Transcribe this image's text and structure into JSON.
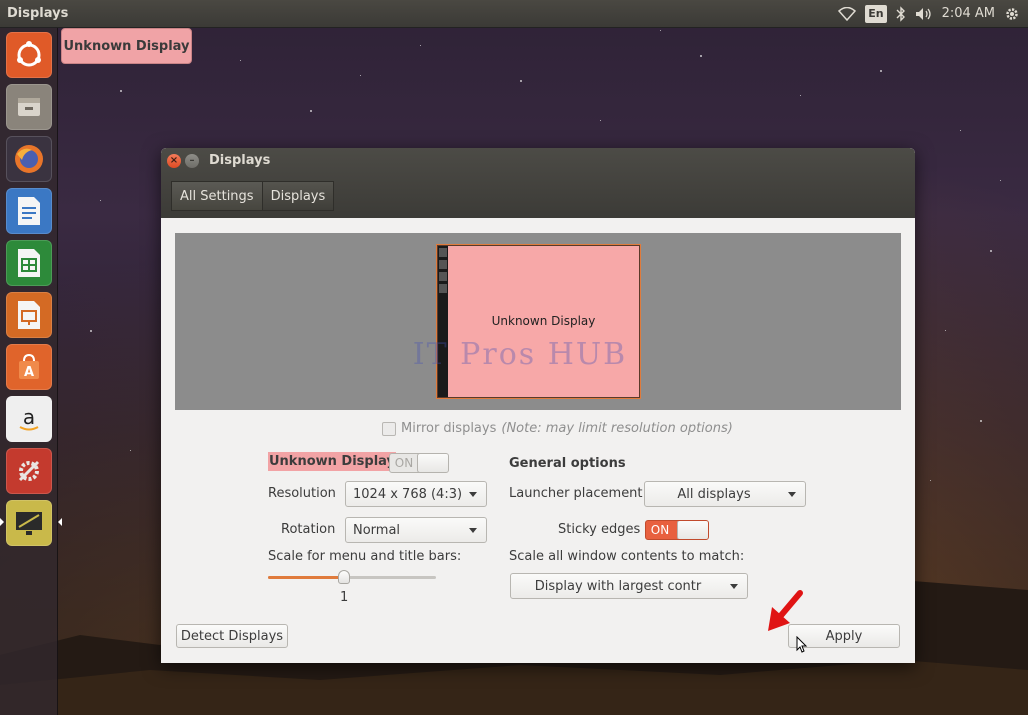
{
  "top_panel": {
    "app_title": "Displays",
    "language": "En",
    "clock": "2:04 AM",
    "icons": [
      "wifi-icon",
      "keyboard-layout-indicator",
      "bluetooth-icon",
      "volume-icon",
      "settings-gear-icon"
    ]
  },
  "launcher": {
    "items": [
      {
        "name": "ubuntu-dash",
        "color": "#e05a28"
      },
      {
        "name": "files",
        "color": "#8a847b"
      },
      {
        "name": "firefox",
        "color": "#e8752a"
      },
      {
        "name": "libreoffice-writer",
        "color": "#3b78c4"
      },
      {
        "name": "libreoffice-calc",
        "color": "#2d8a3a"
      },
      {
        "name": "libreoffice-impress",
        "color": "#d46a24"
      },
      {
        "name": "ubuntu-software",
        "color": "#e0642b"
      },
      {
        "name": "amazon",
        "color": "#efefef"
      },
      {
        "name": "system-settings",
        "color": "#c43a2e"
      },
      {
        "name": "displays-app",
        "color": "#c9b94a"
      }
    ]
  },
  "desktop_label": "Unknown Display",
  "window": {
    "title": "Displays",
    "breadcrumbs": [
      "All Settings",
      "Displays"
    ],
    "preview": {
      "monitor_label": "Unknown Display",
      "watermark": "IT Pros HUB"
    },
    "mirror": {
      "label": "Mirror displays",
      "note": "(Note: may limit resolution options)",
      "checked": false
    },
    "display_section": {
      "name": "Unknown Display",
      "toggle_label": "ON",
      "toggle_state": "off",
      "resolution_label": "Resolution",
      "resolution_value": "1024 x 768 (4:3)",
      "rotation_label": "Rotation",
      "rotation_value": "Normal",
      "scale_label": "Scale for menu and title bars:",
      "scale_value": "1",
      "scale_fraction": 0.45
    },
    "general_options": {
      "heading": "General options",
      "launcher_placement_label": "Launcher placement",
      "launcher_placement_value": "All displays",
      "sticky_edges_label": "Sticky edges",
      "sticky_edges_toggle": "ON",
      "scale_contents_label": "Scale all window contents to match:",
      "scale_contents_value": "Display with largest contr"
    },
    "buttons": {
      "detect": "Detect Displays",
      "apply": "Apply"
    }
  },
  "colors": {
    "accent_orange": "#e8603f",
    "highlight_pink": "#f2a3a5",
    "annotation_red": "#e01414"
  }
}
